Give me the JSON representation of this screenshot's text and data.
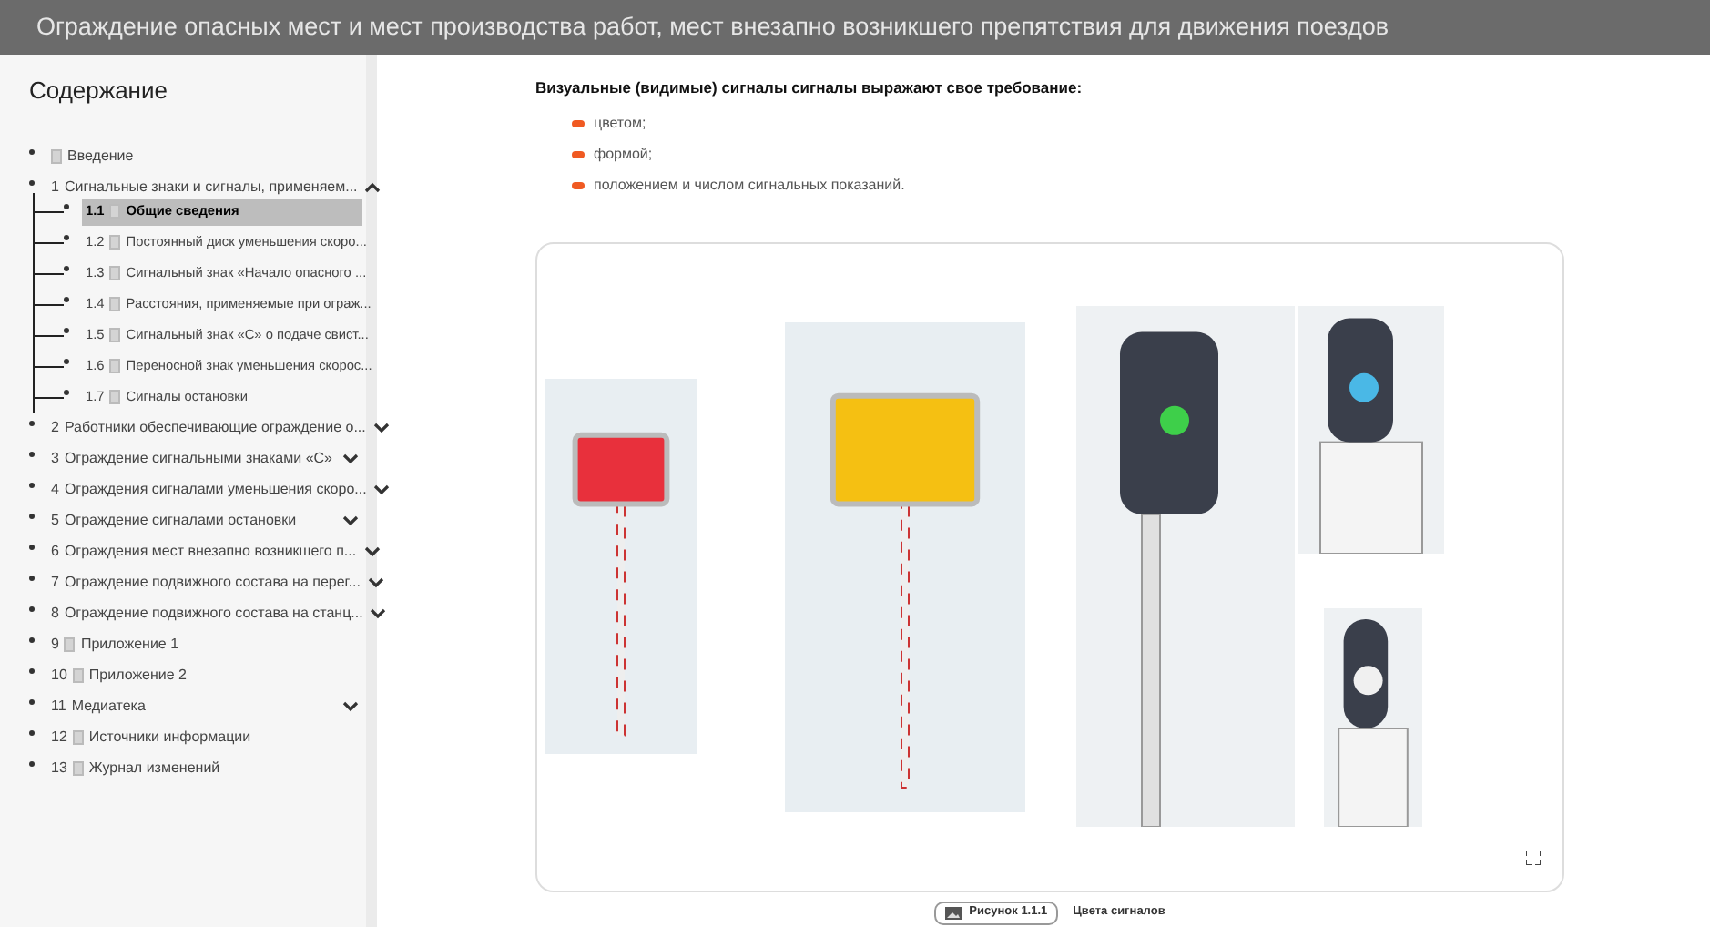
{
  "window": {
    "title": "Ограждение опасных мест и мест производства работ, мест внезапно возникшего препятствия для движения поездов"
  },
  "sidebar": {
    "heading": "Содержание",
    "items": [
      {
        "kind": "page",
        "label": "Введение"
      },
      {
        "kind": "section",
        "number": "1",
        "label": "Сигнальные знаки и сигналы, применяем...",
        "expanded": true,
        "children": [
          {
            "kind": "page",
            "number": "1.1",
            "label": "Общие сведения",
            "selected": true
          },
          {
            "kind": "page",
            "number": "1.2",
            "label": "Постоянный диск уменьшения скоро...",
            "selected": false
          },
          {
            "kind": "page",
            "number": "1.3",
            "label": "Сигнальный знак «Начало опасного ...",
            "selected": false
          },
          {
            "kind": "page",
            "number": "1.4",
            "label": "Расстояния, применяемые при ограж...",
            "selected": false
          },
          {
            "kind": "page",
            "number": "1.5",
            "label": "Сигнальный знак «С» о подаче свист...",
            "selected": false
          },
          {
            "kind": "page",
            "number": "1.6",
            "label": "Переносной знак уменьшения скорос...",
            "selected": false
          },
          {
            "kind": "page",
            "number": "1.7",
            "label": "Сигналы остановки",
            "selected": false
          }
        ]
      },
      {
        "kind": "section",
        "number": "2",
        "label": "Работники обеспечивающие ограждение о...",
        "expanded": false
      },
      {
        "kind": "section",
        "number": "3",
        "label": "Ограждение сигнальными знаками «С»",
        "expanded": false
      },
      {
        "kind": "section",
        "number": "4",
        "label": "Ограждения сигналами уменьшения скоро...",
        "expanded": false
      },
      {
        "kind": "section",
        "number": "5",
        "label": "Ограждение сигналами остановки",
        "expanded": false
      },
      {
        "kind": "section",
        "number": "6",
        "label": "Ограждения мест внезапно возникшего п...",
        "expanded": false
      },
      {
        "kind": "section",
        "number": "7",
        "label": "Ограждение подвижного состава на перег...",
        "expanded": false
      },
      {
        "kind": "section",
        "number": "8",
        "label": "Ограждение подвижного состава на станц...",
        "expanded": false
      },
      {
        "kind": "page",
        "number": "9",
        "label": "Приложение 1"
      },
      {
        "kind": "page",
        "number": "10",
        "label": "Приложение 2"
      },
      {
        "kind": "section",
        "number": "11",
        "label": "Медиатека",
        "expanded": false
      },
      {
        "kind": "page",
        "number": "12",
        "label": "Источники информации"
      },
      {
        "kind": "page",
        "number": "13",
        "label": "Журнал изменений"
      }
    ]
  },
  "content": {
    "heading": "Визуальные (видимые) сигналы сигналы выражают свое требование:",
    "bullets": [
      "цветом;",
      "формой;",
      "положением и числом сигнальных показаний."
    ],
    "figure": {
      "badge": "Рисунок 1.1.1",
      "caption": "Цвета сигналов"
    }
  }
}
